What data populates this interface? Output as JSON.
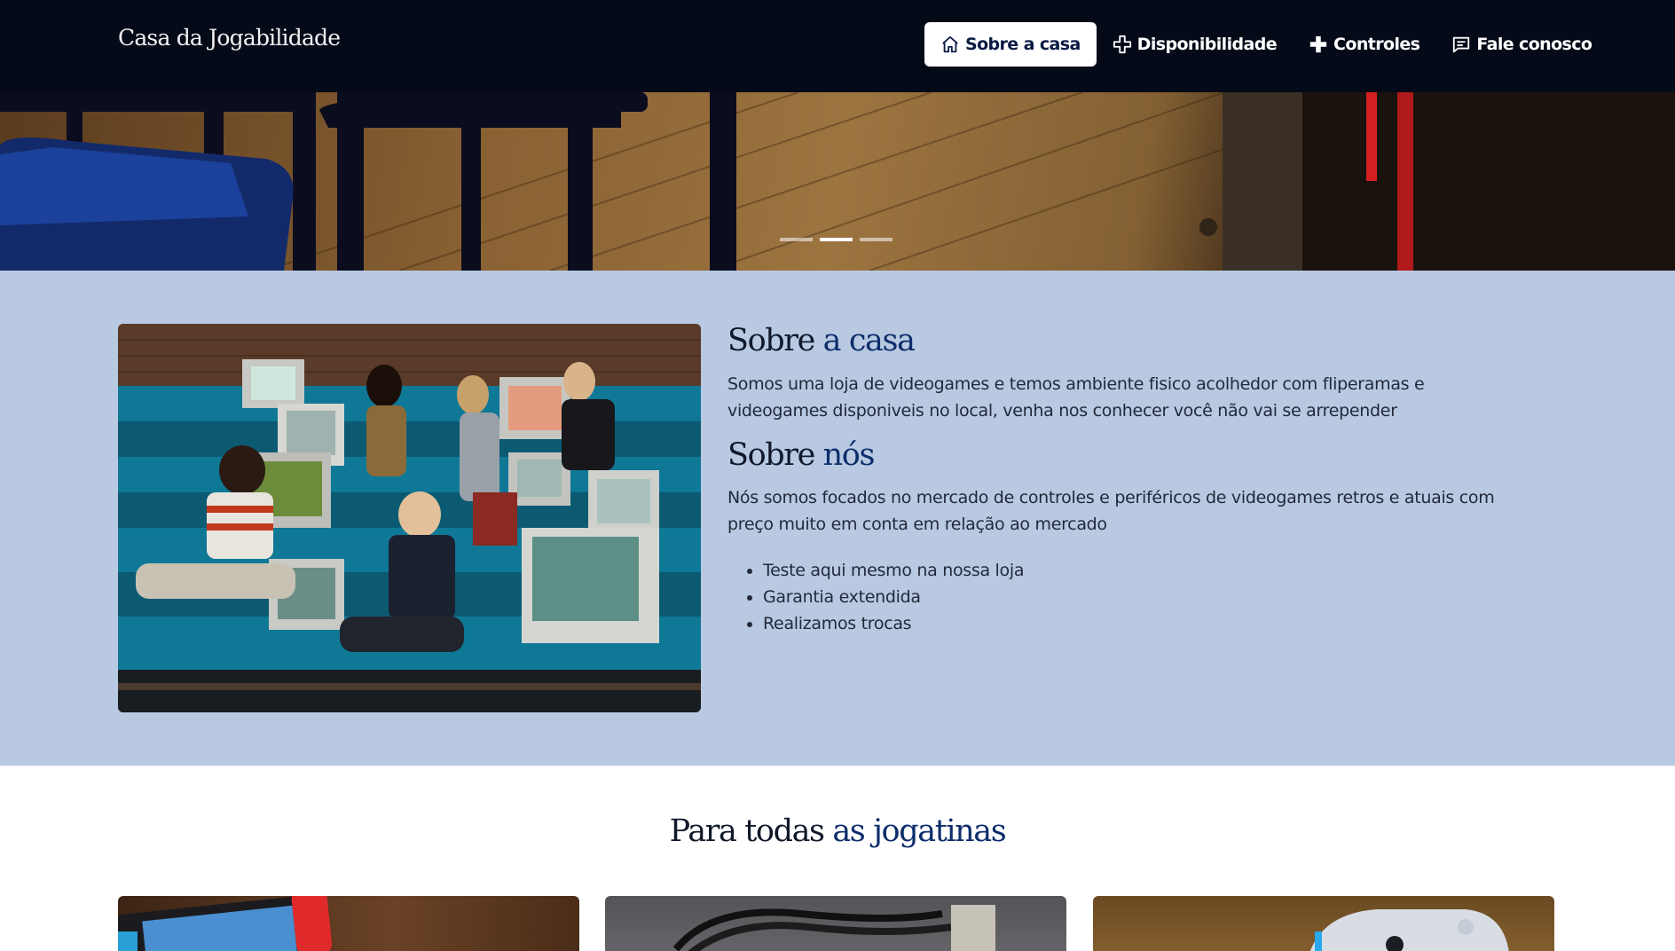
{
  "navbar": {
    "brand": "Casa da Jogabilidade",
    "items": [
      {
        "label": "Sobre a casa",
        "icon": "home-icon",
        "active": true
      },
      {
        "label": "Disponibilidade",
        "icon": "plus-outline-icon",
        "active": false
      },
      {
        "label": "Controles",
        "icon": "plus-filled-icon",
        "active": false
      },
      {
        "label": "Fale conosco",
        "icon": "chat-icon",
        "active": false
      }
    ]
  },
  "hero": {
    "slides": 3,
    "active_slide": 2
  },
  "about": {
    "casa_heading_start": "Sobre",
    "casa_heading_accent": "a casa",
    "casa_text": "Somos uma loja de videogames e temos ambiente fisico acolhedor com fliperamas e videogames disponiveis no local, venha nos conhecer você não vai se arrepender",
    "nos_heading_start": "Sobre",
    "nos_heading_accent": "nós",
    "nos_text": "Nós somos focados no mercado de controles e periféricos de videogames retros e atuais com preço muito em conta em relação ao mercado",
    "features": [
      "Teste aqui mesmo na nossa loja",
      "Garantia extendida",
      "Realizamos trocas"
    ]
  },
  "jogatinas": {
    "title_start": "Para todas",
    "title_accent": "as jogatinas"
  },
  "colors": {
    "navbar_bg": "#040a18",
    "about_bg": "#b8c9e1",
    "heading_accent": "#0d2d6b"
  }
}
